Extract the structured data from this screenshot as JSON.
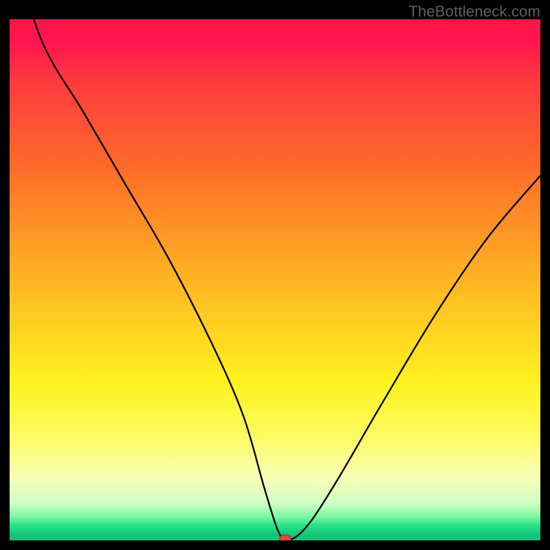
{
  "watermark": "TheBottleneck.com",
  "colors": {
    "frame": "#000000",
    "curve": "#000000",
    "marker_fill": "#e0483d",
    "marker_stroke": "#a02a20",
    "gradient_top": "#ff1744",
    "gradient_bottom": "#12c478"
  },
  "chart_data": {
    "type": "line",
    "title": "",
    "xlabel": "",
    "ylabel": "",
    "xlim": [
      0,
      100
    ],
    "ylim": [
      0,
      100
    ],
    "grid": false,
    "legend": false,
    "series": [
      {
        "name": "bottleneck-curve",
        "x": [
          0,
          6,
          14,
          22,
          30,
          38,
          44,
          48,
          50.5,
          52,
          54,
          57,
          62,
          70,
          80,
          90,
          100
        ],
        "values": [
          116,
          96,
          82,
          68,
          54,
          38,
          24,
          10,
          2,
          0.3,
          0.7,
          4,
          12,
          26,
          43,
          58,
          70
        ]
      }
    ],
    "marker": {
      "x": 52,
      "y": 0.3,
      "shape": "ellipse"
    },
    "background": "vertical-gradient red→orange→yellow→green"
  }
}
